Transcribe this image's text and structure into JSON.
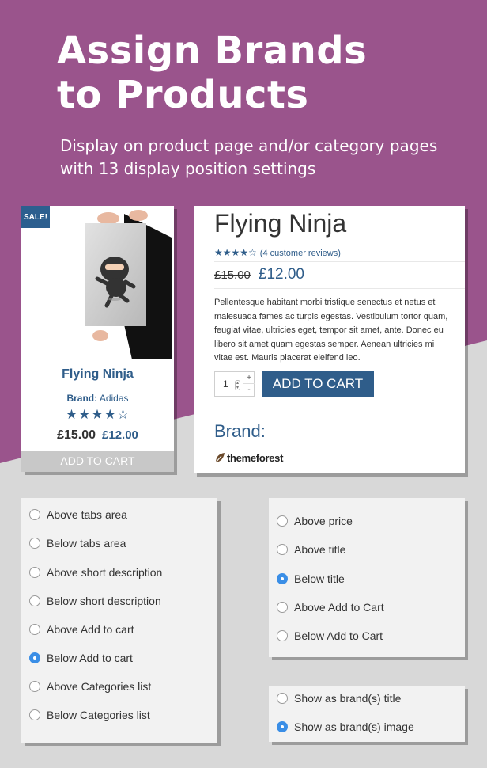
{
  "hero": {
    "title_line1": "Assign Brands",
    "title_line2": "to Products",
    "subtitle_line1": "Display on product page and/or category pages",
    "subtitle_line2": "with 13 display position settings"
  },
  "product_card": {
    "sale_badge": "SALE!",
    "name": "Flying Ninja",
    "brand_label": "Brand:",
    "brand_name": "Adidas",
    "stars": "★★★★☆",
    "old_price": "£15.00",
    "new_price": "£12.00",
    "cart_button": "ADD TO CART"
  },
  "product_detail": {
    "title": "Flying Ninja",
    "stars": "★★★★☆",
    "reviews": "(4 customer reviews)",
    "old_price": "£15.00",
    "new_price": "£12.00",
    "description": "Pellentesque habitant morbi tristique senectus et netus et malesuada fames ac turpis egestas. Vestibulum tortor quam, feugiat vitae, ultricies eget, tempor sit amet, ante. Donec eu libero sit amet quam egestas semper. Aenean ultricies mi vitae est. Mauris placerat eleifend leo.",
    "quantity": "1",
    "qty_plus": "+",
    "qty_minus": "-",
    "cart_button": "ADD TO CART",
    "brand_heading": "Brand:",
    "brand_logo_text": "themeforest"
  },
  "options_product": [
    {
      "label": "Above tabs area",
      "selected": false
    },
    {
      "label": "Below tabs area",
      "selected": false
    },
    {
      "label": "Above short description",
      "selected": false
    },
    {
      "label": "Below short description",
      "selected": false
    },
    {
      "label": "Above Add to cart",
      "selected": false
    },
    {
      "label": "Below Add to cart",
      "selected": true
    },
    {
      "label": "Above Categories list",
      "selected": false
    },
    {
      "label": "Below Categories list",
      "selected": false
    }
  ],
  "options_category": [
    {
      "label": "Above price",
      "selected": false
    },
    {
      "label": "Above title",
      "selected": false
    },
    {
      "label": "Below title",
      "selected": true
    },
    {
      "label": "Above Add to Cart",
      "selected": false
    },
    {
      "label": "Below Add to Cart",
      "selected": false
    }
  ],
  "options_display": [
    {
      "label": "Show as brand(s) title",
      "selected": false
    },
    {
      "label": "Show as brand(s) image",
      "selected": true
    }
  ],
  "colors": {
    "background_purple": "#9a548c",
    "brand_blue": "#2f5d8a",
    "radio_selected": "#3a8ee6"
  }
}
